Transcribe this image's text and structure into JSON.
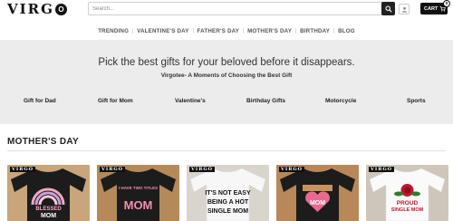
{
  "header": {
    "logo_text": "VIRG",
    "logo_mark": "O",
    "search_placeholder": "Search...",
    "cart_label": "CART",
    "cart_count": "0"
  },
  "nav": {
    "items": [
      {
        "label": "TRENDING"
      },
      {
        "label": "VALENTINE'S DAY"
      },
      {
        "label": "FATHER'S DAY"
      },
      {
        "label": "MOTHER'S DAY"
      },
      {
        "label": "BIRTHDAY"
      },
      {
        "label": "BLOG"
      }
    ]
  },
  "banner": {
    "title": "Pick the best gifts for your beloved before it disappears.",
    "subtitle": "Virgotee- A Moments of Choosing the Best Gift",
    "categories": [
      {
        "label": "Gift for Dad"
      },
      {
        "label": "Gift for Mom"
      },
      {
        "label": "Valentine's"
      },
      {
        "label": "Birthday Gifts"
      },
      {
        "label": "Motorcycle"
      },
      {
        "label": "Sports"
      }
    ]
  },
  "section": {
    "title": "MOTHER'S DAY"
  },
  "products": [
    {
      "brand": "VIRGO",
      "line1": "BLESSED",
      "line2": "MOM",
      "bg": "#c8a57a",
      "shirt": "#1c1c1c",
      "text_color": "#f2a7c3"
    },
    {
      "brand": "VIRGO",
      "line1": "I HAVE TWO TITLES",
      "line2": "MOM",
      "bg": "#b48a5a",
      "shirt": "#1c1c1c",
      "text_color": "#f48fb1"
    },
    {
      "brand": "VIRGO",
      "line1": "IT'S NOT EASY",
      "line2": "BEING A HOT",
      "line3": "SINGLE MOM",
      "bg": "#d9d4cc",
      "shirt": "#f7f7f7",
      "text_color": "#111111"
    },
    {
      "brand": "VIRGO",
      "line1": "MOM",
      "line2": "",
      "bg": "#b8875a",
      "shirt": "#1c1c1c",
      "text_color": "#e86a8e"
    },
    {
      "brand": "VIRGO",
      "line1": "PROUD",
      "line2": "SINGLE MOM",
      "bg": "#cfc6bb",
      "shirt": "#fafafa",
      "text_color": "#c0182d"
    }
  ],
  "colors": {
    "banner_bg": "#ececec",
    "accent_dark": "#111111"
  },
  "icons": {
    "search": "search-icon",
    "account": "user-icon",
    "cart": "cart-icon"
  }
}
